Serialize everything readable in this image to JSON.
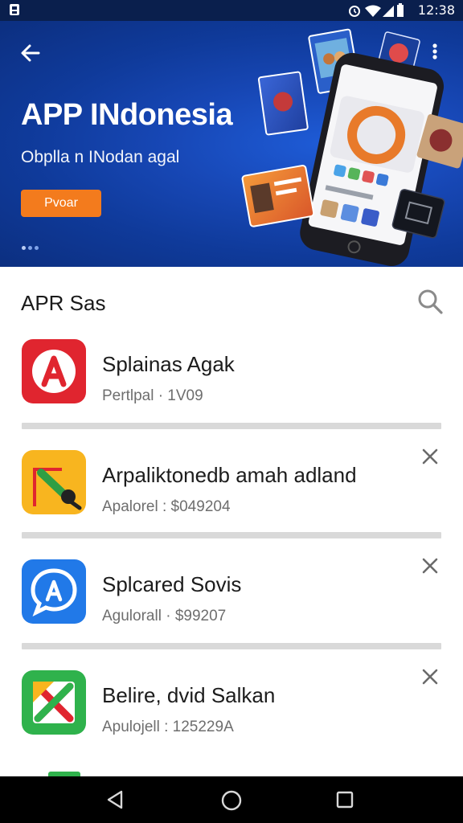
{
  "status_bar": {
    "time": "12:38",
    "icons": [
      "sim-icon",
      "alarm-icon",
      "wifi-icon",
      "signal-icon",
      "battery-icon"
    ]
  },
  "banner": {
    "title": "APP INdonesia",
    "subtitle": "Obplla n INodan agal",
    "button_label": "Pvoar",
    "page_dots": 3,
    "button_color": "#f37b1d",
    "background_color": "#1747b5"
  },
  "section": {
    "title": "APR Sas"
  },
  "apps": [
    {
      "name": "Splainas Agak",
      "meta": "Pertlpal · 1V09",
      "icon": "red-a-logo-icon",
      "dismissible": false
    },
    {
      "name": "Arpaliktonedb amah adland",
      "meta": "Apalorel : $049204",
      "icon": "yellow-app-icon",
      "dismissible": true
    },
    {
      "name": "Splcared Sovis",
      "meta": "Agulorall · $99207",
      "icon": "blue-chat-a-icon",
      "dismissible": true
    },
    {
      "name": "Belire, dvid Salkan",
      "meta": "Apulojell : 125229A",
      "icon": "green-x-icon",
      "dismissible": true
    }
  ],
  "nav_bar": {
    "buttons": [
      "back-icon",
      "home-icon",
      "recents-icon"
    ]
  }
}
